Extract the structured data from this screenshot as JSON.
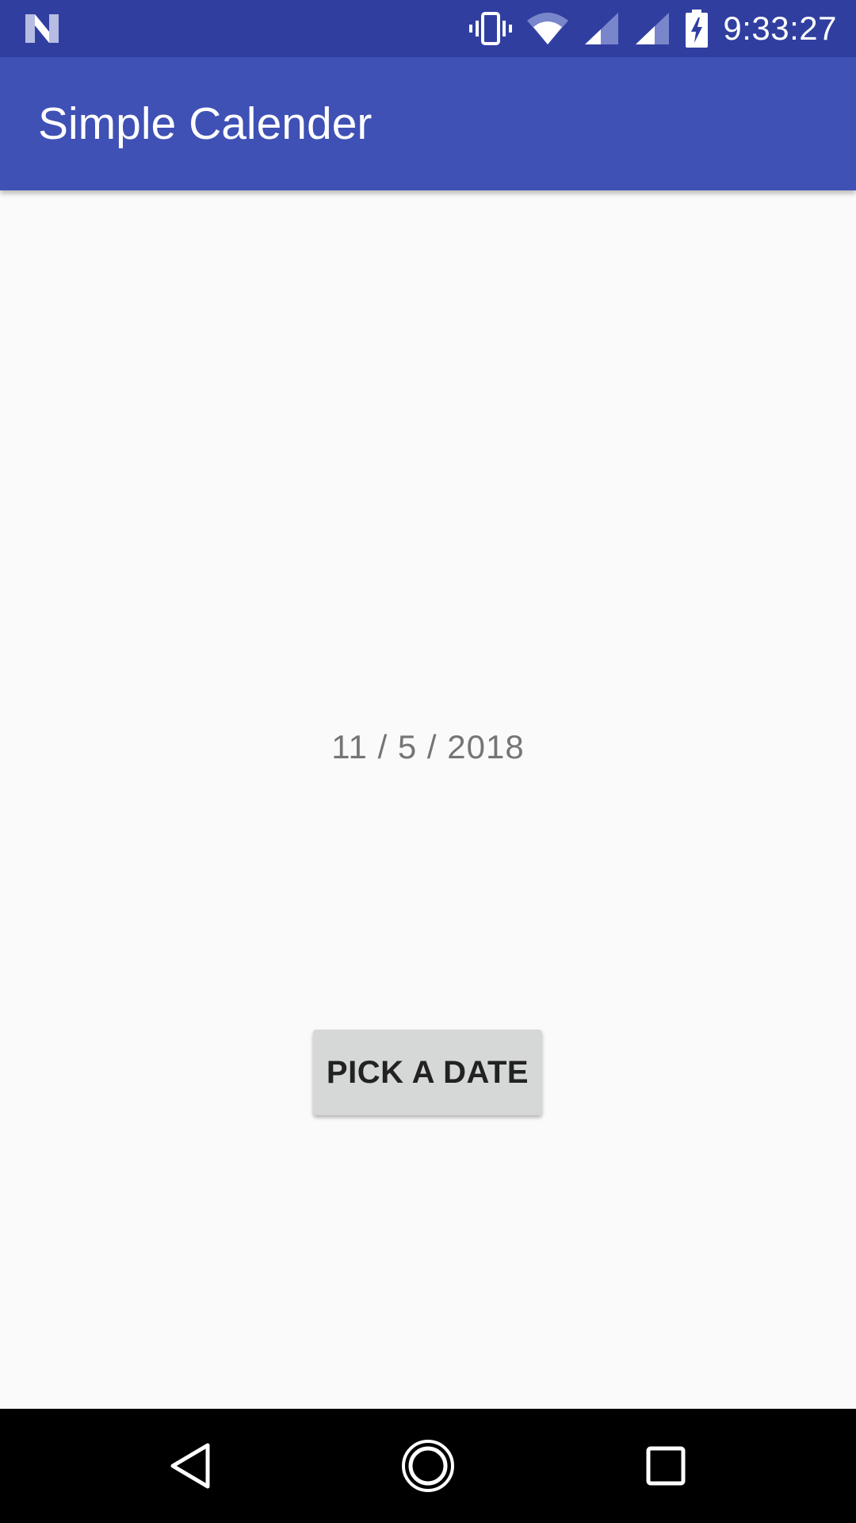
{
  "status_bar": {
    "time": "9:33:27",
    "icons": [
      "android-n-icon",
      "vibrate-icon",
      "wifi-icon",
      "signal-icon",
      "signal-icon",
      "battery-charging-icon"
    ]
  },
  "app_bar": {
    "title": "Simple Calender"
  },
  "main": {
    "date_text": "11 / 5 / 2018",
    "pick_button_label": "PICK A DATE"
  },
  "nav_bar": {
    "icons": [
      "back-icon",
      "home-icon",
      "recents-icon"
    ]
  },
  "colors": {
    "status_bar": "#303f9f",
    "app_bar": "#3f51b5",
    "background": "#fafafa",
    "button": "#d6d7d7",
    "date_text": "#757575",
    "nav_bar": "#000000"
  }
}
